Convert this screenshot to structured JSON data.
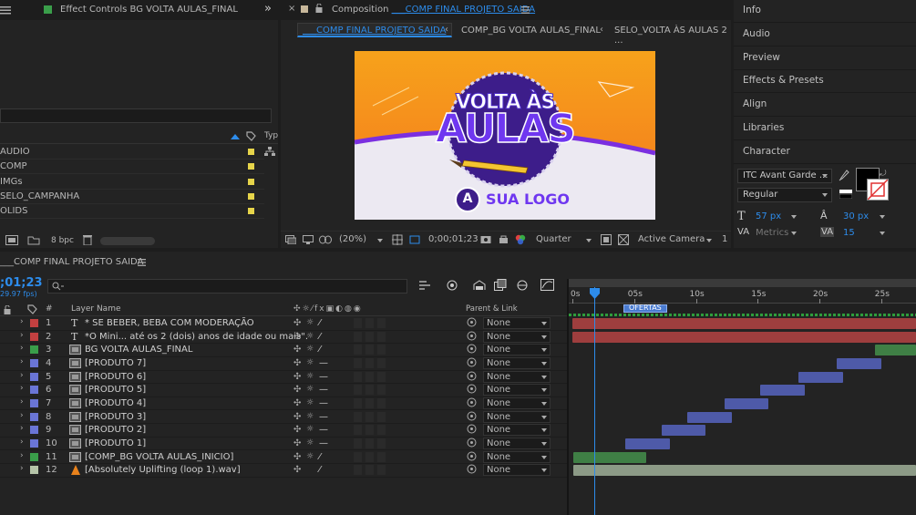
{
  "effect_controls": {
    "tab_label": "Effect Controls",
    "tab_target": "BG VOLTA AULAS_FINAL",
    "collapse_glyph": "»",
    "columns": {
      "type": "Typ"
    },
    "project_items": [
      {
        "name": "AUDIO",
        "color": "#e6d44a"
      },
      {
        "name": "COMP",
        "color": "#e6d44a"
      },
      {
        "name": "IMGs",
        "color": "#e6d44a"
      },
      {
        "name": "SELO_CAMPANHA",
        "color": "#e6d44a"
      },
      {
        "name": "OLIDS",
        "color": "#e6d44a"
      }
    ],
    "footer_bpc": "8 bpc"
  },
  "composition": {
    "title_prefix": "Composition",
    "title_name": "___COMP FINAL PROJETO SAIDA",
    "tabs": [
      {
        "label": "___COMP FINAL PROJETO SAIDA",
        "active": true
      },
      {
        "label": "COMP_BG VOLTA AULAS_FINAL",
        "active": false
      },
      {
        "label": "SELO_VOLTA ÀS AULAS 2 ...",
        "active": false
      }
    ],
    "preview": {
      "line1": "VOLTA ÀS",
      "line2": "AULAS",
      "logo_letter": "A",
      "logo_text": "SUA LOGO"
    },
    "toolbar": {
      "zoom": "(20%)",
      "timecode": "0;00;01;23",
      "resolution": "Quarter",
      "camera": "Active Camera",
      "views": "1"
    }
  },
  "sidebar": {
    "items": [
      "Info",
      "Audio",
      "Preview",
      "Effects & Presets",
      "Align",
      "Libraries",
      "Character"
    ],
    "character": {
      "font": "ITC Avant Garde ...",
      "style": "Regular",
      "font_size": "57 px",
      "leading": "30 px",
      "kerning": "Metrics",
      "tracking": "15"
    }
  },
  "timeline": {
    "comp_name": "___COMP FINAL PROJETO SAIDA",
    "timecode": ";01;23",
    "fps": "29.97 fps)",
    "columns": {
      "num": "#",
      "layer_name": "Layer Name",
      "parent": "Parent & Link"
    },
    "ruler": [
      "0s",
      "05s",
      "10s",
      "15s",
      "20s",
      "25s"
    ],
    "marker_label": "OFERTAS",
    "layers": [
      {
        "num": "1",
        "kind": "T",
        "name": "* SE BEBER, BEBA COM MODERAÇÃO",
        "label_color": "#c24040",
        "parent": "None",
        "bar": {
          "start": 0,
          "end": 30,
          "color": "#9e3e3e"
        }
      },
      {
        "num": "2",
        "kind": "T",
        "name": "*O Mini... até os 2 (dois) anos de idade ou mais\".",
        "label_color": "#c24040",
        "parent": "None",
        "bar": {
          "start": 0,
          "end": 30,
          "color": "#9e3e3e"
        }
      },
      {
        "num": "3",
        "kind": "comp",
        "name": "BG VOLTA AULAS_FINAL",
        "label_color": "#3a9e4a",
        "parent": "None",
        "bar": {
          "start": 24.5,
          "end": 30,
          "color": "#3f7f45"
        }
      },
      {
        "num": "4",
        "kind": "comp",
        "name": "[PRODUTO 7]",
        "label_color": "#6a75d6",
        "parent": "None",
        "bar": {
          "start": 21.4,
          "end": 25,
          "color": "#4e5aa8"
        }
      },
      {
        "num": "5",
        "kind": "comp",
        "name": "[PRODUTO 6]",
        "label_color": "#6a75d6",
        "parent": "None",
        "bar": {
          "start": 18.3,
          "end": 21.9,
          "color": "#4e5aa8"
        }
      },
      {
        "num": "6",
        "kind": "comp",
        "name": "[PRODUTO 5]",
        "label_color": "#6a75d6",
        "parent": "None",
        "bar": {
          "start": 15.2,
          "end": 18.8,
          "color": "#4e5aa8"
        }
      },
      {
        "num": "7",
        "kind": "comp",
        "name": "[PRODUTO 4]",
        "label_color": "#6a75d6",
        "parent": "None",
        "bar": {
          "start": 12.3,
          "end": 15.9,
          "color": "#4e5aa8"
        }
      },
      {
        "num": "8",
        "kind": "comp",
        "name": "[PRODUTO 3]",
        "label_color": "#6a75d6",
        "parent": "None",
        "bar": {
          "start": 9.3,
          "end": 12.9,
          "color": "#4e5aa8"
        }
      },
      {
        "num": "9",
        "kind": "comp",
        "name": "[PRODUTO 2]",
        "label_color": "#6a75d6",
        "parent": "None",
        "bar": {
          "start": 7.2,
          "end": 10.8,
          "color": "#4e5aa8"
        }
      },
      {
        "num": "10",
        "kind": "comp",
        "name": "[PRODUTO 1]",
        "label_color": "#6a75d6",
        "parent": "None",
        "bar": {
          "start": 4.3,
          "end": 7.9,
          "color": "#4e5aa8"
        }
      },
      {
        "num": "11",
        "kind": "comp",
        "name": "[COMP_BG VOLTA AULAS_INICIO]",
        "label_color": "#3a9e4a",
        "parent": "None",
        "bar": {
          "start": 0.1,
          "end": 6,
          "color": "#3f7f45"
        }
      },
      {
        "num": "12",
        "kind": "audio",
        "name": "[Absolutely Uplifting (loop 1).wav]",
        "label_color": "#b5c4a8",
        "parent": "None",
        "bar": {
          "start": 0.1,
          "end": 30,
          "color": "#8c9a86"
        }
      }
    ]
  }
}
